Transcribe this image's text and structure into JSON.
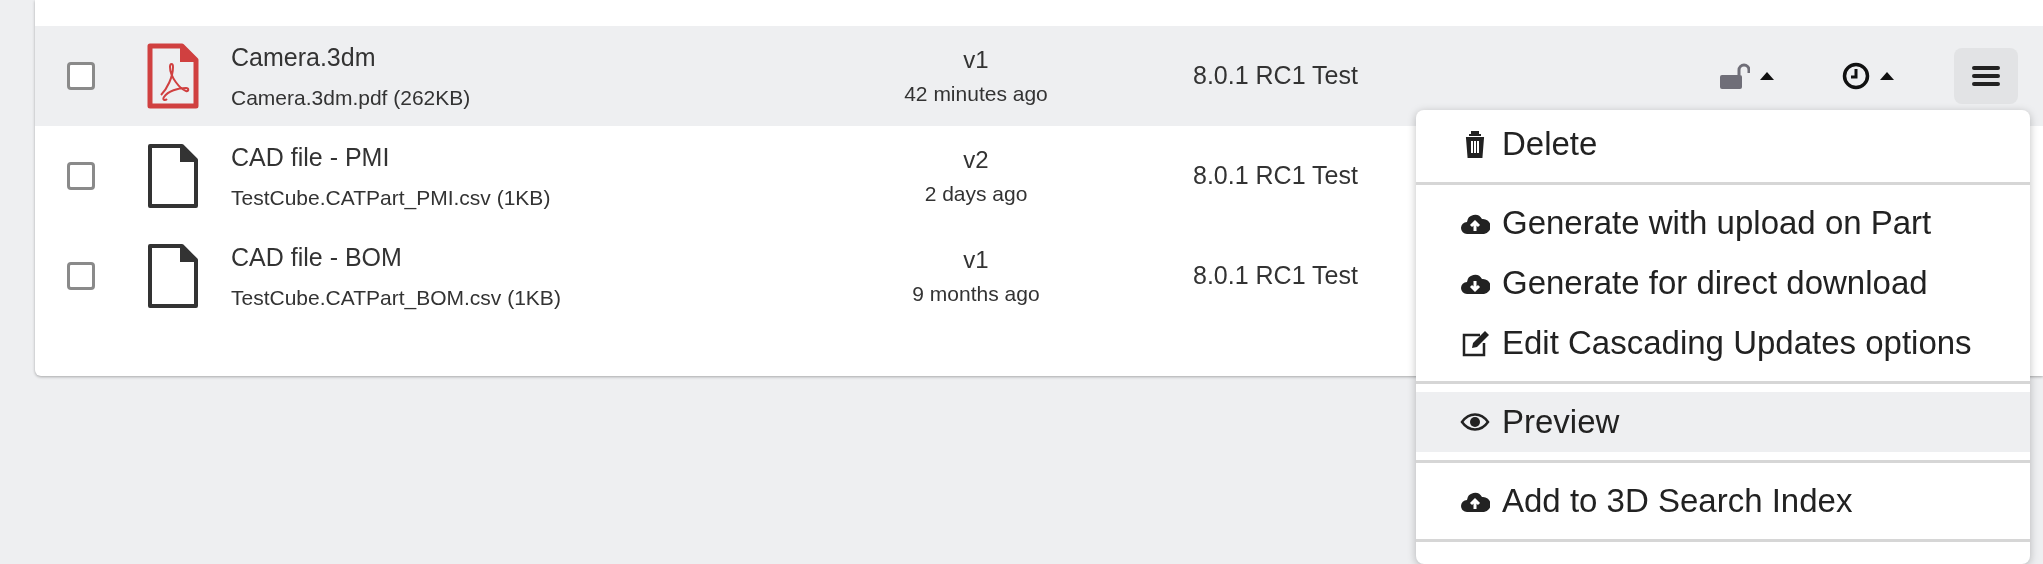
{
  "rows": [
    {
      "title": "Camera.3dm",
      "file": "Camera.3dm.pdf (262KB)",
      "kind": "pdf",
      "version": "v1",
      "age": "42 minutes ago",
      "release": "8.0.1 RC1 Test",
      "checked": false,
      "selected": true,
      "locked": false
    },
    {
      "title": "CAD file - PMI",
      "file": "TestCube.CATPart_PMI.csv (1KB)",
      "kind": "file",
      "version": "v2",
      "age": "2 days ago",
      "release": "8.0.1 RC1 Test",
      "checked": false,
      "selected": false
    },
    {
      "title": "CAD file - BOM",
      "file": "TestCube.CATPart_BOM.csv (1KB)",
      "kind": "file",
      "version": "v1",
      "age": "9 months ago",
      "release": "8.0.1 RC1 Test",
      "checked": false,
      "selected": false
    }
  ],
  "menu": {
    "groups": [
      [
        {
          "label": "Delete",
          "kind": "trash",
          "selected": false
        }
      ],
      [
        {
          "label": "Generate with upload on Part",
          "kind": "upload",
          "selected": false
        },
        {
          "label": "Generate for direct download",
          "kind": "download",
          "selected": false
        },
        {
          "label": "Edit Cascading Updates options",
          "kind": "edit",
          "selected": false
        }
      ],
      [
        {
          "label": "Preview",
          "kind": "preview",
          "selected": true
        }
      ],
      [
        {
          "label": "Add to 3D Search Index",
          "kind": "upload",
          "selected": false
        }
      ]
    ]
  }
}
